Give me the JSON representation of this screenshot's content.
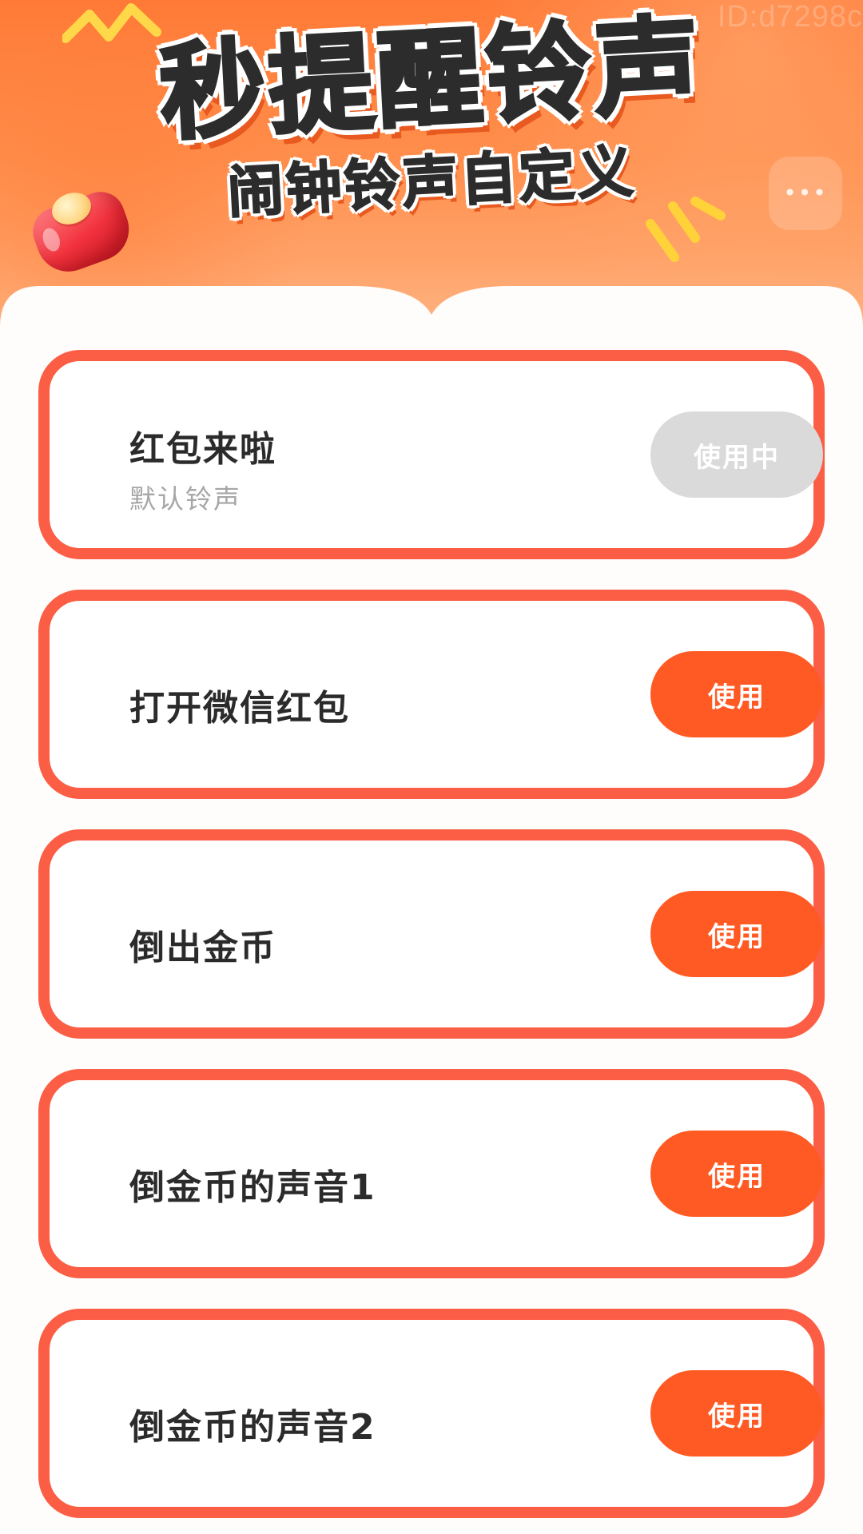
{
  "header": {
    "title": "秒提醒铃声",
    "subtitle": "闹钟铃声自定义",
    "watermark": "ID:d7298c",
    "more_icon": "more-dots-icon",
    "bell_icon": "red-bell-icon"
  },
  "colors": {
    "header_gradient_top": "#ff7a36",
    "header_gradient_bottom": "#ffb98a",
    "card_border": "#fb5e44",
    "button_active": "#ff5a24",
    "button_in_use": "#dadada",
    "title_text": "#2b2b2b",
    "subtitle_text": "#a6a6a6"
  },
  "ringtones": [
    {
      "name": "红包来啦",
      "subtitle": "默认铃声",
      "button_label": "使用中",
      "state": "in_use"
    },
    {
      "name": "打开微信红包",
      "subtitle": "",
      "button_label": "使用",
      "state": "available"
    },
    {
      "name": "倒出金币",
      "subtitle": "",
      "button_label": "使用",
      "state": "available"
    },
    {
      "name": "倒金币的声音1",
      "subtitle": "",
      "button_label": "使用",
      "state": "available"
    },
    {
      "name": "倒金币的声音2",
      "subtitle": "",
      "button_label": "使用",
      "state": "available"
    }
  ]
}
